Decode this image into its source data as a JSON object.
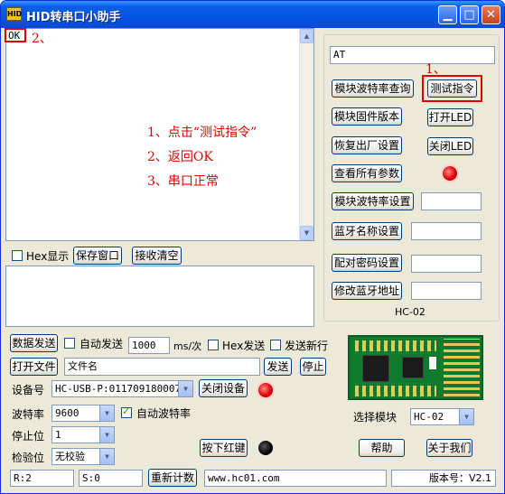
{
  "window": {
    "title": "HID转串口小助手",
    "app_icon": "HID"
  },
  "receive": {
    "text": "OK"
  },
  "annotations": {
    "num2": "2、",
    "num1": "1、",
    "line1": "1、点击“测试指令”",
    "line2": "2、返回OK",
    "line3": "3、串口正常"
  },
  "receive_bar": {
    "hex_display": "Hex显示",
    "save_window": "保存窗口",
    "clear_receive": "接收清空"
  },
  "right_panel": {
    "command_value": "AT",
    "btn_query_baud": "模块波特率查询",
    "btn_test_cmd": "测试指令",
    "btn_firmware": "模块固件版本",
    "btn_led_on": "打开LED",
    "btn_factory": "恢复出厂设置",
    "btn_led_off": "关闭LED",
    "btn_all_params": "查看所有参数",
    "btn_set_baud": "模块波特率设置",
    "btn_bt_name": "蓝牙名称设置",
    "btn_pair_pwd": "配对密码设置",
    "btn_bt_addr": "修改蓝牙地址",
    "model_label": "HC-02"
  },
  "send_row": {
    "send_data": "数据发送",
    "auto_send": "自动发送",
    "interval": "1000",
    "unit": "ms/次",
    "hex_send": "Hex发送",
    "send_newline": "发送新行"
  },
  "file_row": {
    "open_file": "打开文件",
    "file_name": "文件名",
    "send": "发送",
    "stop": "停止"
  },
  "device_row": {
    "label": "设备号",
    "device": "HC-USB-P:011709180007",
    "close_device": "关闭设备"
  },
  "baud_row": {
    "label": "波特率",
    "value": "9600",
    "auto_baud": "自动波特率"
  },
  "stop_row": {
    "label": "停止位",
    "value": "1"
  },
  "parity_row": {
    "label": "检验位",
    "value": "无校验",
    "red_key": "按下红键"
  },
  "module": {
    "label": "选择模块",
    "value": "HC-02"
  },
  "help": {
    "help": "帮助",
    "about": "关于我们"
  },
  "statusbar": {
    "rx": "R:2",
    "tx": "S:0",
    "recount": "重新计数",
    "url": "www.hc01.com",
    "version": "版本号：V2.1"
  },
  "colors": {
    "titlebar": "#0554e3",
    "annotation": "#e00000",
    "pcb": "#0f7a2e"
  }
}
